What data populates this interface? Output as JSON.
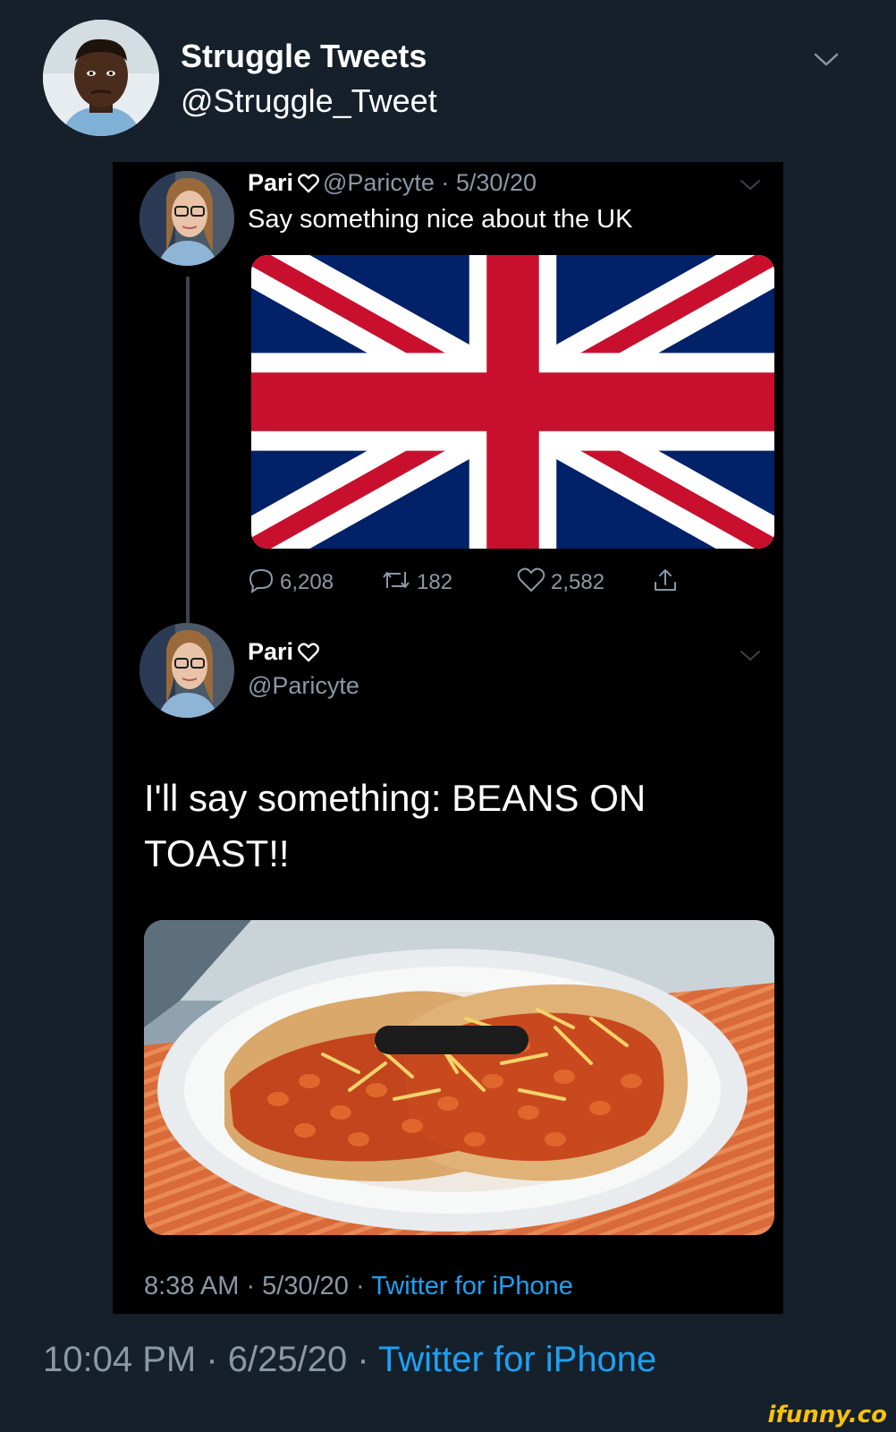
{
  "outer_tweet": {
    "display_name": "Struggle Tweets",
    "handle": "@Struggle_Tweet",
    "footer_time": "10:04 PM · 6/25/20 · ",
    "footer_source": "Twitter for iPhone"
  },
  "original_tweet": {
    "display_name": "Pari",
    "meta": "@Paricyte · 5/30/20",
    "text": "Say something nice about the UK",
    "replies": "6,208",
    "retweets": "182",
    "likes": "2,582"
  },
  "reply_tweet": {
    "display_name": "Pari",
    "handle": "@Paricyte",
    "text": "I'll say something: BEANS ON TOAST!!",
    "footer_time": "8:38 AM · 5/30/20 · ",
    "footer_source": "Twitter for iPhone"
  },
  "watermark": "ifunny.co",
  "colors": {
    "background": "#15202b",
    "inner_background": "#000000",
    "link": "#1da1f2",
    "muted": "#8b98a5",
    "flag_blue": "#012169",
    "flag_red": "#c8102e"
  },
  "icons": [
    "chevron-down-icon",
    "heart-icon",
    "reply-icon",
    "retweet-icon",
    "like-icon",
    "share-icon"
  ]
}
